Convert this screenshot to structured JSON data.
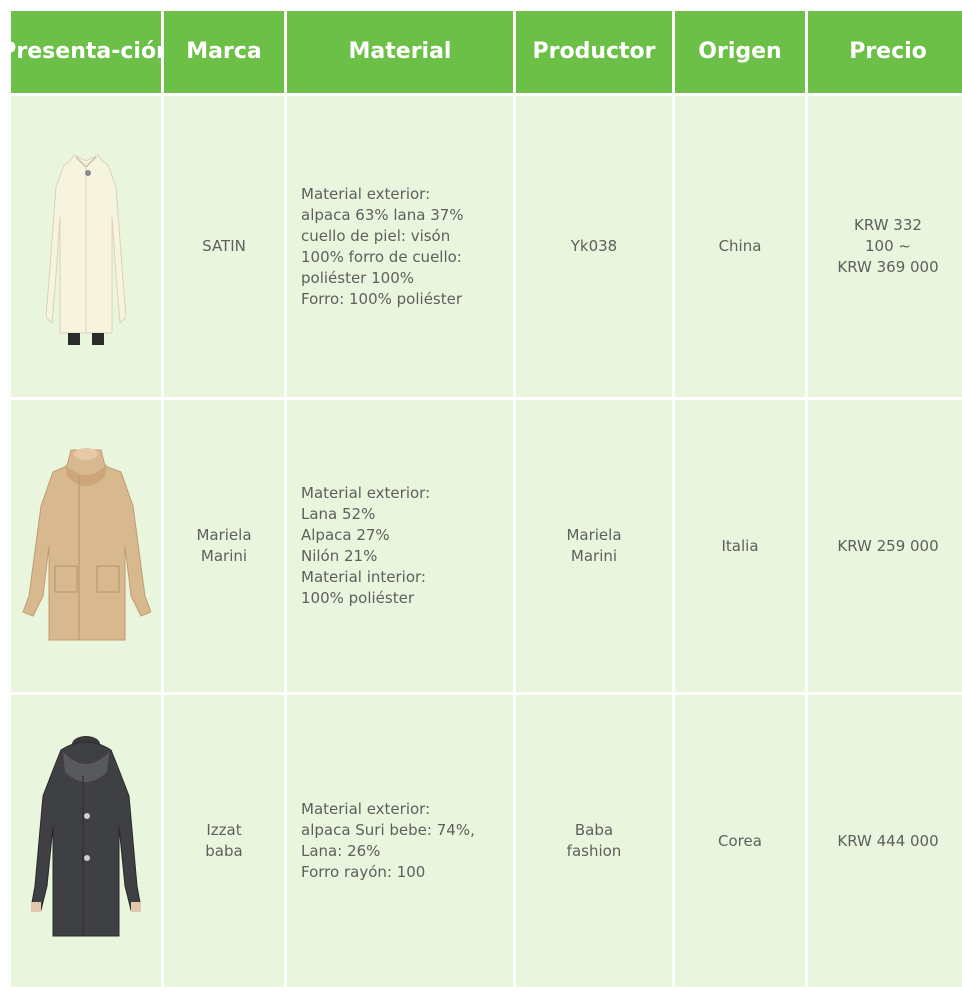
{
  "headers": [
    "Presenta-\nción",
    "Marca",
    "Material",
    "Productor",
    "Origen",
    "Precio"
  ],
  "header_lines": {
    "c1": [
      "Presenta-",
      "ción"
    ],
    "c2": "Marca",
    "c3": "Material",
    "c4": "Productor",
    "c5": "Origen",
    "c6": "Precio"
  },
  "rows": [
    {
      "image_desc": "cream-coat-icon",
      "brand": "SATIN",
      "material_lines": [
        "Material exterior:",
        "alpaca 63% lana 37%",
        "cuello de piel: visón",
        "100% forro de cuello:",
        "poliéster 100%",
        "Forro: 100% poliéster"
      ],
      "producer": "Yk038",
      "origin": "China",
      "price_lines": [
        "KRW 332",
        "100 ~",
        "KRW 369 000"
      ]
    },
    {
      "image_desc": "camel-coat-icon",
      "brand_lines": [
        "Mariela",
        "Marini"
      ],
      "material_lines": [
        "Material exterior:",
        "Lana 52%",
        "Alpaca 27%",
        "Nilón 21%",
        "Material interior:",
        "100% poliéster"
      ],
      "producer_lines": [
        "Mariela",
        "Marini"
      ],
      "origin": "Italia",
      "price": "KRW 259 000"
    },
    {
      "image_desc": "charcoal-coat-icon",
      "brand_lines": [
        "Izzat",
        "baba"
      ],
      "material_lines": [
        "Material exterior:",
        "alpaca Suri bebe: 74%,",
        "Lana: 26%",
        "Forro rayón: 100"
      ],
      "producer_lines": [
        "Baba",
        "fashion"
      ],
      "origin": "Corea",
      "price": "KRW 444 000"
    }
  ],
  "colors": {
    "header_bg": "#6cc047",
    "header_text": "#ffffff",
    "cell_bg": "#e9f5dc",
    "cell_text": "#5f5f5f"
  }
}
